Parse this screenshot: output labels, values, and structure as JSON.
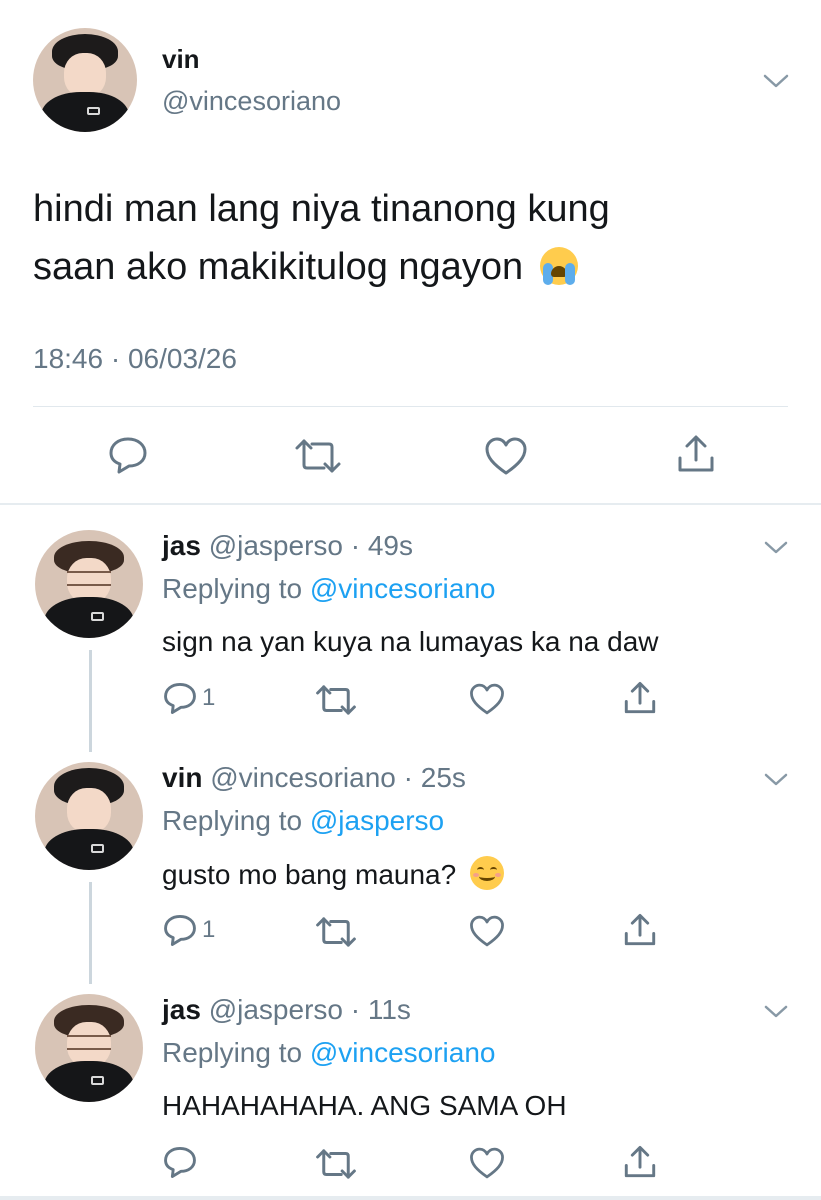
{
  "main_tweet": {
    "name": "vin",
    "handle": "@vincesoriano",
    "text_line1": "hindi man lang niya tinanong kung",
    "text_line2": "saan ako makikitulog ngayon",
    "timestamp": "18:46 · 06/03/26",
    "icons": [
      "reply-icon",
      "retweet-icon",
      "like-icon",
      "share-icon"
    ]
  },
  "replies": [
    {
      "name": "jas",
      "meta": "@jasperso · 49s",
      "replying_prefix": "Replying to",
      "replying_to": "@vincesoriano",
      "text": "sign na yan kuya na lumayas ka na daw",
      "reply_count": "1"
    },
    {
      "name": "vin",
      "meta": "@vincesoriano · 25s",
      "replying_prefix": "Replying to",
      "replying_to": "@jasperso",
      "text": "gusto mo bang mauna?",
      "reply_count": "1"
    },
    {
      "name": "jas",
      "meta": "@jasperso · 11s",
      "replying_prefix": "Replying to",
      "replying_to": "@vincesoriano",
      "text": "HAHAHAHAHA. ANG SAMA OH",
      "reply_count": ""
    }
  ],
  "colors": {
    "text": "#14171a",
    "secondary": "#657786",
    "link": "#1da1f2",
    "divider": "#e1e8ed",
    "thread_line": "#ccd6dd"
  }
}
